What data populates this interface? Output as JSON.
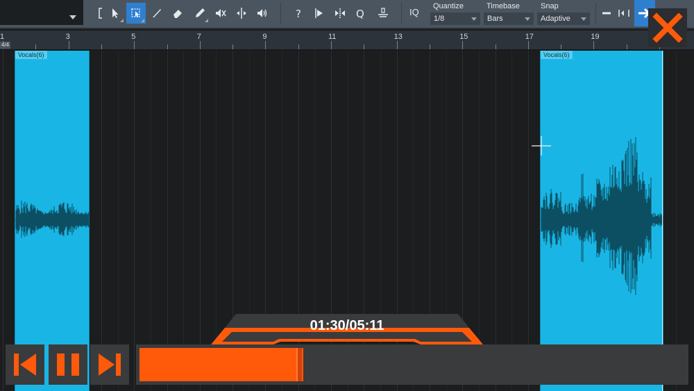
{
  "toolbar": {
    "tools": [
      "range-bracket",
      "arrow-tool",
      "range-tool",
      "split-tool",
      "eraser-tool",
      "paint-tool",
      "mute-tool",
      "bend-tool",
      "listen-tool",
      "help",
      "audio-bend",
      "transient",
      "quantize",
      "follow"
    ],
    "iq_label": "IQ",
    "quantize": {
      "label": "Quantize",
      "value": "1/8"
    },
    "timebase": {
      "label": "Timebase",
      "value": "Bars"
    },
    "snap": {
      "label": "Snap",
      "value": "Adaptive"
    }
  },
  "ruler": {
    "bars": [
      "1",
      "3",
      "5",
      "7",
      "9",
      "11",
      "13",
      "15",
      "17",
      "19"
    ],
    "time_signature": "4/4"
  },
  "clips": [
    {
      "name": "Vocals(6)"
    },
    {
      "name": "Vocals(6)"
    }
  ],
  "player": {
    "time_display": "01:30/05:11",
    "progress": 0.3,
    "accent": "#ff5a0a"
  },
  "colors": {
    "clip": "#19b6e5",
    "waveform": "#0c4f62",
    "toolbar": "#4a5560"
  }
}
